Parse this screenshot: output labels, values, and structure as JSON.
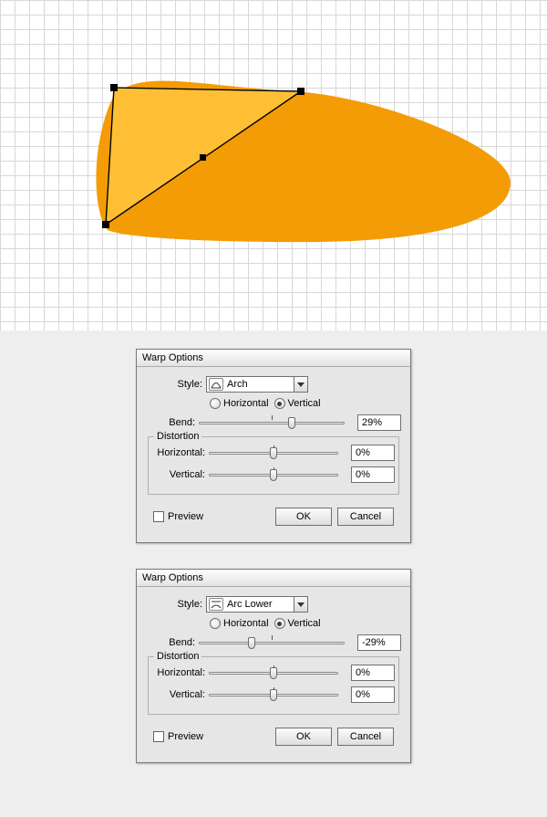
{
  "dialogs": [
    {
      "title": "Warp Options",
      "style_label": "Style:",
      "style_value": "Arch",
      "orient_h": "Horizontal",
      "orient_v": "Vertical",
      "orient_checked": "v",
      "bend_label": "Bend:",
      "bend_value": "29%",
      "bend_thumb_pct": 64,
      "distortion_legend": "Distortion",
      "dist_h_label": "Horizontal:",
      "dist_h_value": "0%",
      "dist_h_thumb_pct": 50,
      "dist_v_label": "Vertical:",
      "dist_v_value": "0%",
      "dist_v_thumb_pct": 50,
      "preview_label": "Preview",
      "ok_label": "OK",
      "cancel_label": "Cancel",
      "style_icon": "arch"
    },
    {
      "title": "Warp Options",
      "style_label": "Style:",
      "style_value": "Arc Lower",
      "orient_h": "Horizontal",
      "orient_v": "Vertical",
      "orient_checked": "v",
      "bend_label": "Bend:",
      "bend_value": "-29%",
      "bend_thumb_pct": 36,
      "distortion_legend": "Distortion",
      "dist_h_label": "Horizontal:",
      "dist_h_value": "0%",
      "dist_h_thumb_pct": 50,
      "dist_v_label": "Vertical:",
      "dist_v_value": "0%",
      "dist_v_thumb_pct": 50,
      "preview_label": "Preview",
      "ok_label": "OK",
      "cancel_label": "Cancel",
      "style_icon": "arc-lower"
    }
  ]
}
